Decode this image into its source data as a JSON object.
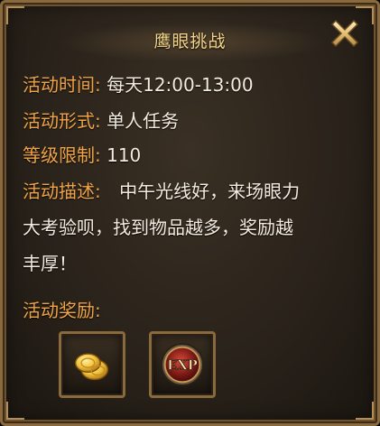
{
  "window": {
    "title": "鹰眼挑战",
    "close_icon": "close-x-icon"
  },
  "info": {
    "time_label": "活动时间",
    "time_value": "每天12:00-13:00",
    "form_label": "活动形式",
    "form_value": "单人任务",
    "level_label": "等级限制",
    "level_value": "110",
    "desc_label": "活动描述",
    "desc_line1": "中午光线好，来场眼力",
    "desc_line2": "大考验呗，找到物品越多，奖励越",
    "desc_line3": "丰厚！",
    "separator": ":"
  },
  "rewards": {
    "title": "活动奖励:",
    "items": [
      {
        "icon": "gold-coins-icon"
      },
      {
        "icon": "exp-orb-icon",
        "label": "EXP"
      }
    ]
  },
  "colors": {
    "label": "#f1a447",
    "value": "#f3ecdf",
    "title": "#f4d58a",
    "frame": "#8a6a3c"
  }
}
